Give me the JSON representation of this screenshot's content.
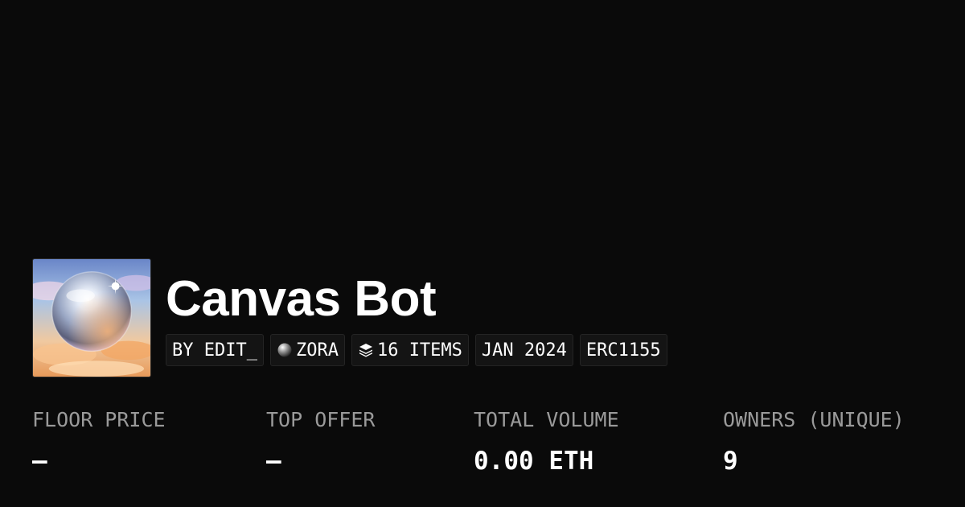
{
  "collection": {
    "name": "Canvas Bot",
    "image_icon": "glass-orb-in-sky-artwork"
  },
  "tags": {
    "creator": "BY EDIT_",
    "chain": "ZORA",
    "chain_icon": "zora-orb-icon",
    "items": "16 ITEMS",
    "items_icon": "layers-icon",
    "date": "JAN 2024",
    "standard": "ERC1155"
  },
  "stats": {
    "floor_price": {
      "label": "FLOOR PRICE",
      "value": "–"
    },
    "top_offer": {
      "label": "TOP OFFER",
      "value": "–"
    },
    "total_volume": {
      "label": "TOTAL VOLUME",
      "value": "0.00 ETH"
    },
    "owners": {
      "label": "OWNERS (UNIQUE)",
      "value": "9"
    }
  },
  "colors": {
    "background": "#0a0a0a",
    "text_primary": "#ffffff",
    "text_muted": "#9a9a9a",
    "tag_background": "#141414"
  }
}
